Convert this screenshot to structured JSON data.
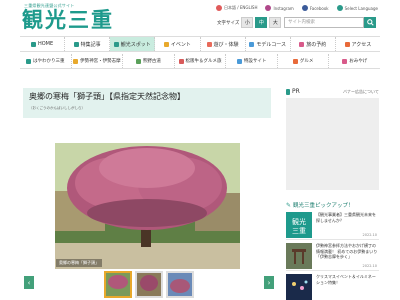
{
  "header": {
    "tagline": "三重県観光連盟公式サイト",
    "logo": "観光三重",
    "links": [
      {
        "label": "日本語 / ENGLISH",
        "color": "#e05a5a"
      },
      {
        "label": "Instagram",
        "color": "#b0488a"
      },
      {
        "label": "Facebook",
        "color": "#3b5b9a"
      },
      {
        "label": "Select Language",
        "color": "#2a9a8a"
      }
    ],
    "font_size_label": "文字サイズ",
    "font_sizes": [
      "小",
      "中",
      "大"
    ],
    "search_placeholder": "サイト内検索"
  },
  "nav_primary": [
    {
      "label": "HOME",
      "icon": "home-icon",
      "color": "#2a9a8a"
    },
    {
      "label": "特集記事",
      "icon": "book-icon",
      "color": "#2a9a8a"
    },
    {
      "label": "観光スポット",
      "icon": "spot-icon",
      "color": "#2a9a8a",
      "active": true
    },
    {
      "label": "イベント",
      "icon": "event-icon",
      "color": "#e8a92c"
    },
    {
      "label": "遊び・体験",
      "icon": "play-icon",
      "color": "#e86a5a"
    },
    {
      "label": "モデルコース",
      "icon": "course-icon",
      "color": "#4a9ad8"
    },
    {
      "label": "旅の予約",
      "icon": "reserve-icon",
      "color": "#d85a8a"
    },
    {
      "label": "アクセス",
      "icon": "access-icon",
      "color": "#e86a3a"
    }
  ],
  "nav_secondary": [
    {
      "label": "はやわかり三重",
      "icon": "map-icon",
      "color": "#2a9a8a"
    },
    {
      "label": "伊勢神宮・伊勢志摩",
      "icon": "shrine-icon",
      "color": "#e8a92c"
    },
    {
      "label": "熊野古道",
      "icon": "trail-icon",
      "color": "#5aa05a"
    },
    {
      "label": "松阪牛＆グルメ旅",
      "icon": "food-icon",
      "color": "#d85a5a"
    },
    {
      "label": "特設サイト",
      "icon": "special-icon",
      "color": "#4a9ad8"
    },
    {
      "label": "グルメ",
      "icon": "gourmet-icon",
      "color": "#e86a3a"
    },
    {
      "label": "おみやげ",
      "icon": "gift-icon",
      "color": "#d85a8a"
    }
  ],
  "article": {
    "title": "奥郷の寒梅「獅子頭」【県指定天然記念物】",
    "ruby": "（おくごうのかんばいししがしら）",
    "caption": "奥郷の寒梅「獅子頭」",
    "prev": "‹",
    "next": "›"
  },
  "sidebar": {
    "pr_label": "PR",
    "pr_about": "バナー広告について",
    "pickup_title": "観光三重ピックアップ！",
    "pickups": [
      {
        "text": "【観光事業者】三重県観光未来を探しませんか？",
        "date": "2022.10"
      },
      {
        "text": "伊勢神宮参拝方法やおかげ横丁の情報満載！ 初めてのお伊勢まいり「伊勢志摩を歩く」",
        "date": "2022.10"
      },
      {
        "text": "クリスマスイベント＆イルミネーション特集！",
        "date": ""
      }
    ]
  }
}
